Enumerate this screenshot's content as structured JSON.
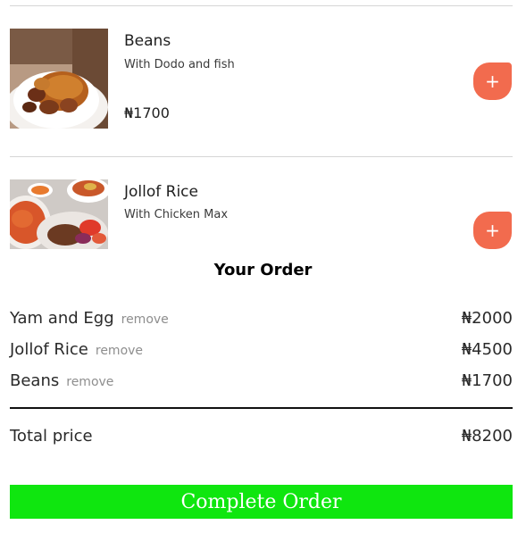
{
  "menu": {
    "items": [
      {
        "name": "Beans",
        "description": "With Dodo and fish",
        "price": "₦1700",
        "add_label": "+"
      },
      {
        "name": "Jollof Rice",
        "description": "With Chicken Max",
        "add_label": "+"
      }
    ]
  },
  "order": {
    "title": "Your Order",
    "remove_label": "remove",
    "rows": [
      {
        "name": "Yam and Egg",
        "price": "₦2000"
      },
      {
        "name": "Jollof Rice",
        "price": "₦4500"
      },
      {
        "name": "Beans",
        "price": "₦1700"
      }
    ],
    "total_label": "Total price",
    "total_value": "₦8200",
    "complete_label": "Complete Order"
  },
  "colors": {
    "add_button": "#f26b4e",
    "complete_button": "#0fe60f"
  }
}
